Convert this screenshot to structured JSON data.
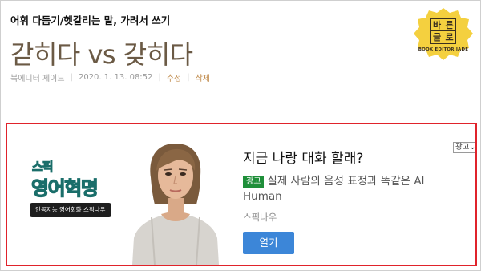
{
  "post": {
    "category": "어휘 다듬기/헷갈리는 말, 가려서 쓰기",
    "title": "갇히다 vs 갖히다",
    "author": "북에디터 제이드",
    "date": "2020. 1. 13. 08:52",
    "edit_label": "수정",
    "delete_label": "삭제"
  },
  "logo": {
    "chars": [
      "바",
      "른",
      "글",
      "로"
    ],
    "subtitle": "BOOK EDITOR JADE",
    "color": "#f4d03f"
  },
  "ad": {
    "brand_top": "스픽",
    "brand_main": "영어혁명",
    "brand_tagline": "인공지능 영어회화 스픽나우",
    "headline": "지금 나랑 대화 할래?",
    "badge": "광고",
    "description": "실제 사람의 음성 표정과 똑같은 AI Human",
    "advertiser": "스픽나우",
    "cta_label": "열기",
    "ad_choices_label": "광고",
    "highlight_color": "#e0232b"
  }
}
